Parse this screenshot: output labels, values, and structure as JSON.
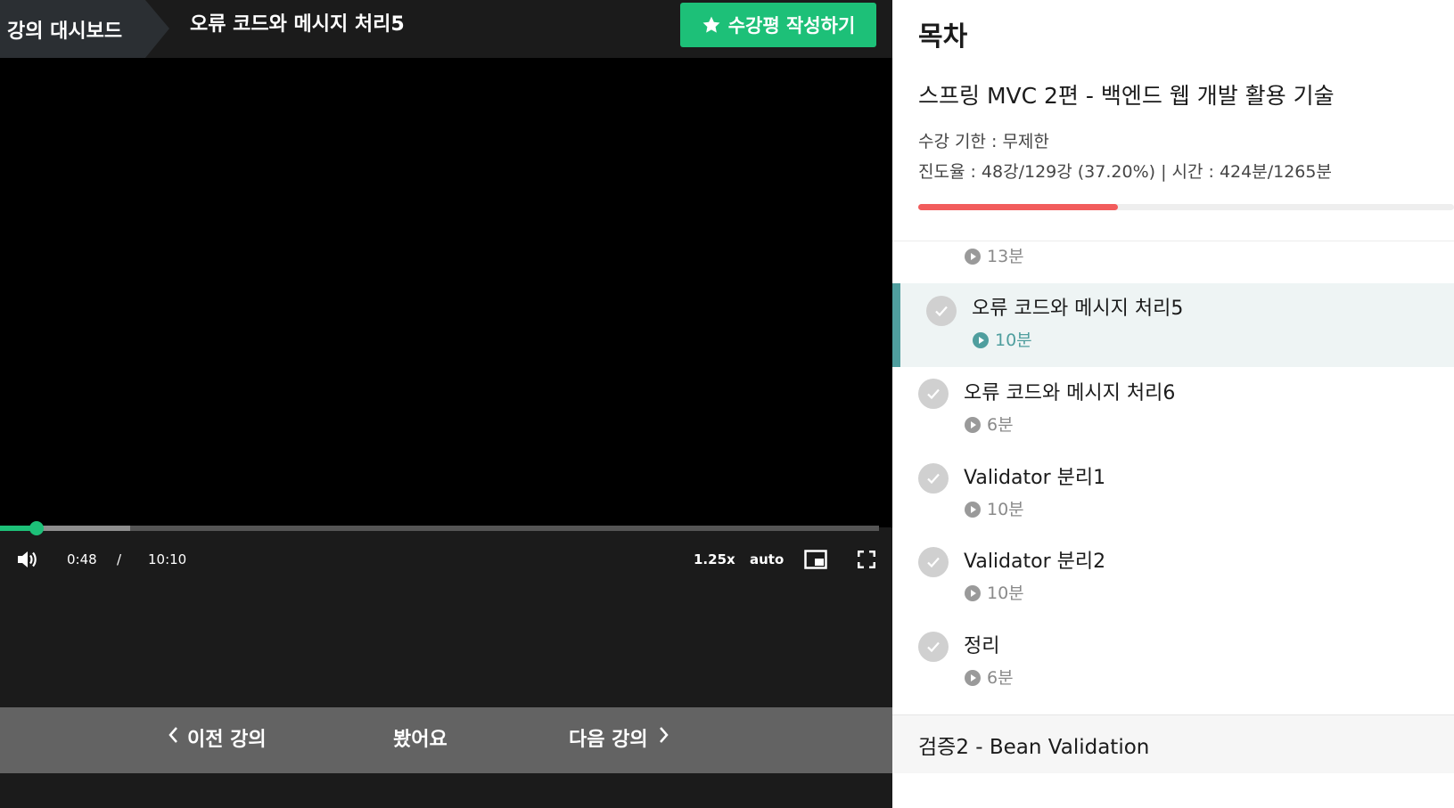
{
  "header": {
    "dashboard_label": "강의 대시보드",
    "lesson_title": "오류 코드와 메시지 처리5",
    "review_button_label": "수강평 작성하기"
  },
  "player": {
    "current_time": "0:48",
    "separator": "/",
    "duration": "10:10",
    "speed": "1.25x",
    "quality": "auto",
    "played_fraction": 0.042,
    "buffered_fraction": 0.148
  },
  "bottom_nav": {
    "prev_label": "이전 강의",
    "watched_label": "봤어요",
    "next_label": "다음 강의"
  },
  "sidebar": {
    "title": "목차",
    "course_title": "스프링 MVC 2편 - 백엔드 웹 개발 활용 기술",
    "period": "수강 기한 : 무제한",
    "progress_text": "진도율 : 48강/129강 (37.20%) | 시간 : 424분/1265분",
    "progress_fraction": 0.372,
    "partial_item_duration": "13분",
    "lessons": [
      {
        "title": "오류 코드와 메시지 처리5",
        "duration": "10분",
        "active": true
      },
      {
        "title": "오류 코드와 메시지 처리6",
        "duration": "6분",
        "active": false
      },
      {
        "title": "Validator 분리1",
        "duration": "10분",
        "active": false
      },
      {
        "title": "Validator 분리2",
        "duration": "10분",
        "active": false
      },
      {
        "title": "정리",
        "duration": "6분",
        "active": false
      }
    ],
    "next_section": "검증2 - Bean Validation"
  },
  "colors": {
    "accent_green": "#1dc078",
    "active_teal": "#4f9e9e",
    "course_progress": "#f25c5c"
  }
}
